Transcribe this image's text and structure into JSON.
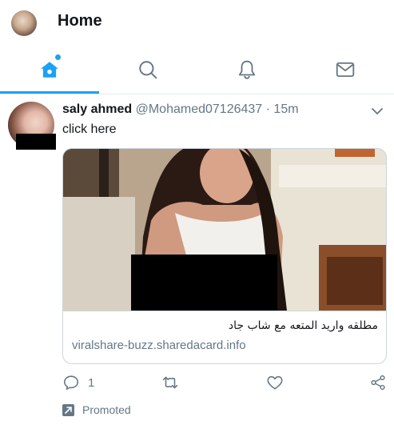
{
  "header": {
    "title": "Home"
  },
  "tabs": [
    {
      "name": "home",
      "icon": "home-icon",
      "active": true
    },
    {
      "name": "search",
      "icon": "search-icon",
      "active": false
    },
    {
      "name": "notifications",
      "icon": "bell-icon",
      "active": false
    },
    {
      "name": "messages",
      "icon": "envelope-icon",
      "active": false
    }
  ],
  "tweet": {
    "name": "saly ahmed",
    "handle": "@Mohamed07126437",
    "separator": "·",
    "time": "15m",
    "text": "click here",
    "card": {
      "title": "مطلقه واريد المتعه مع شاب جاد",
      "domain": "viralshare-buzz.sharedacard.info"
    },
    "actions": {
      "reply_count": "1",
      "retweet_count": "",
      "like_count": ""
    },
    "promoted_label": "Promoted"
  },
  "colors": {
    "accent": "#1da1f2",
    "muted": "#657786",
    "text": "#14171a",
    "border": "#ccd6dd"
  }
}
